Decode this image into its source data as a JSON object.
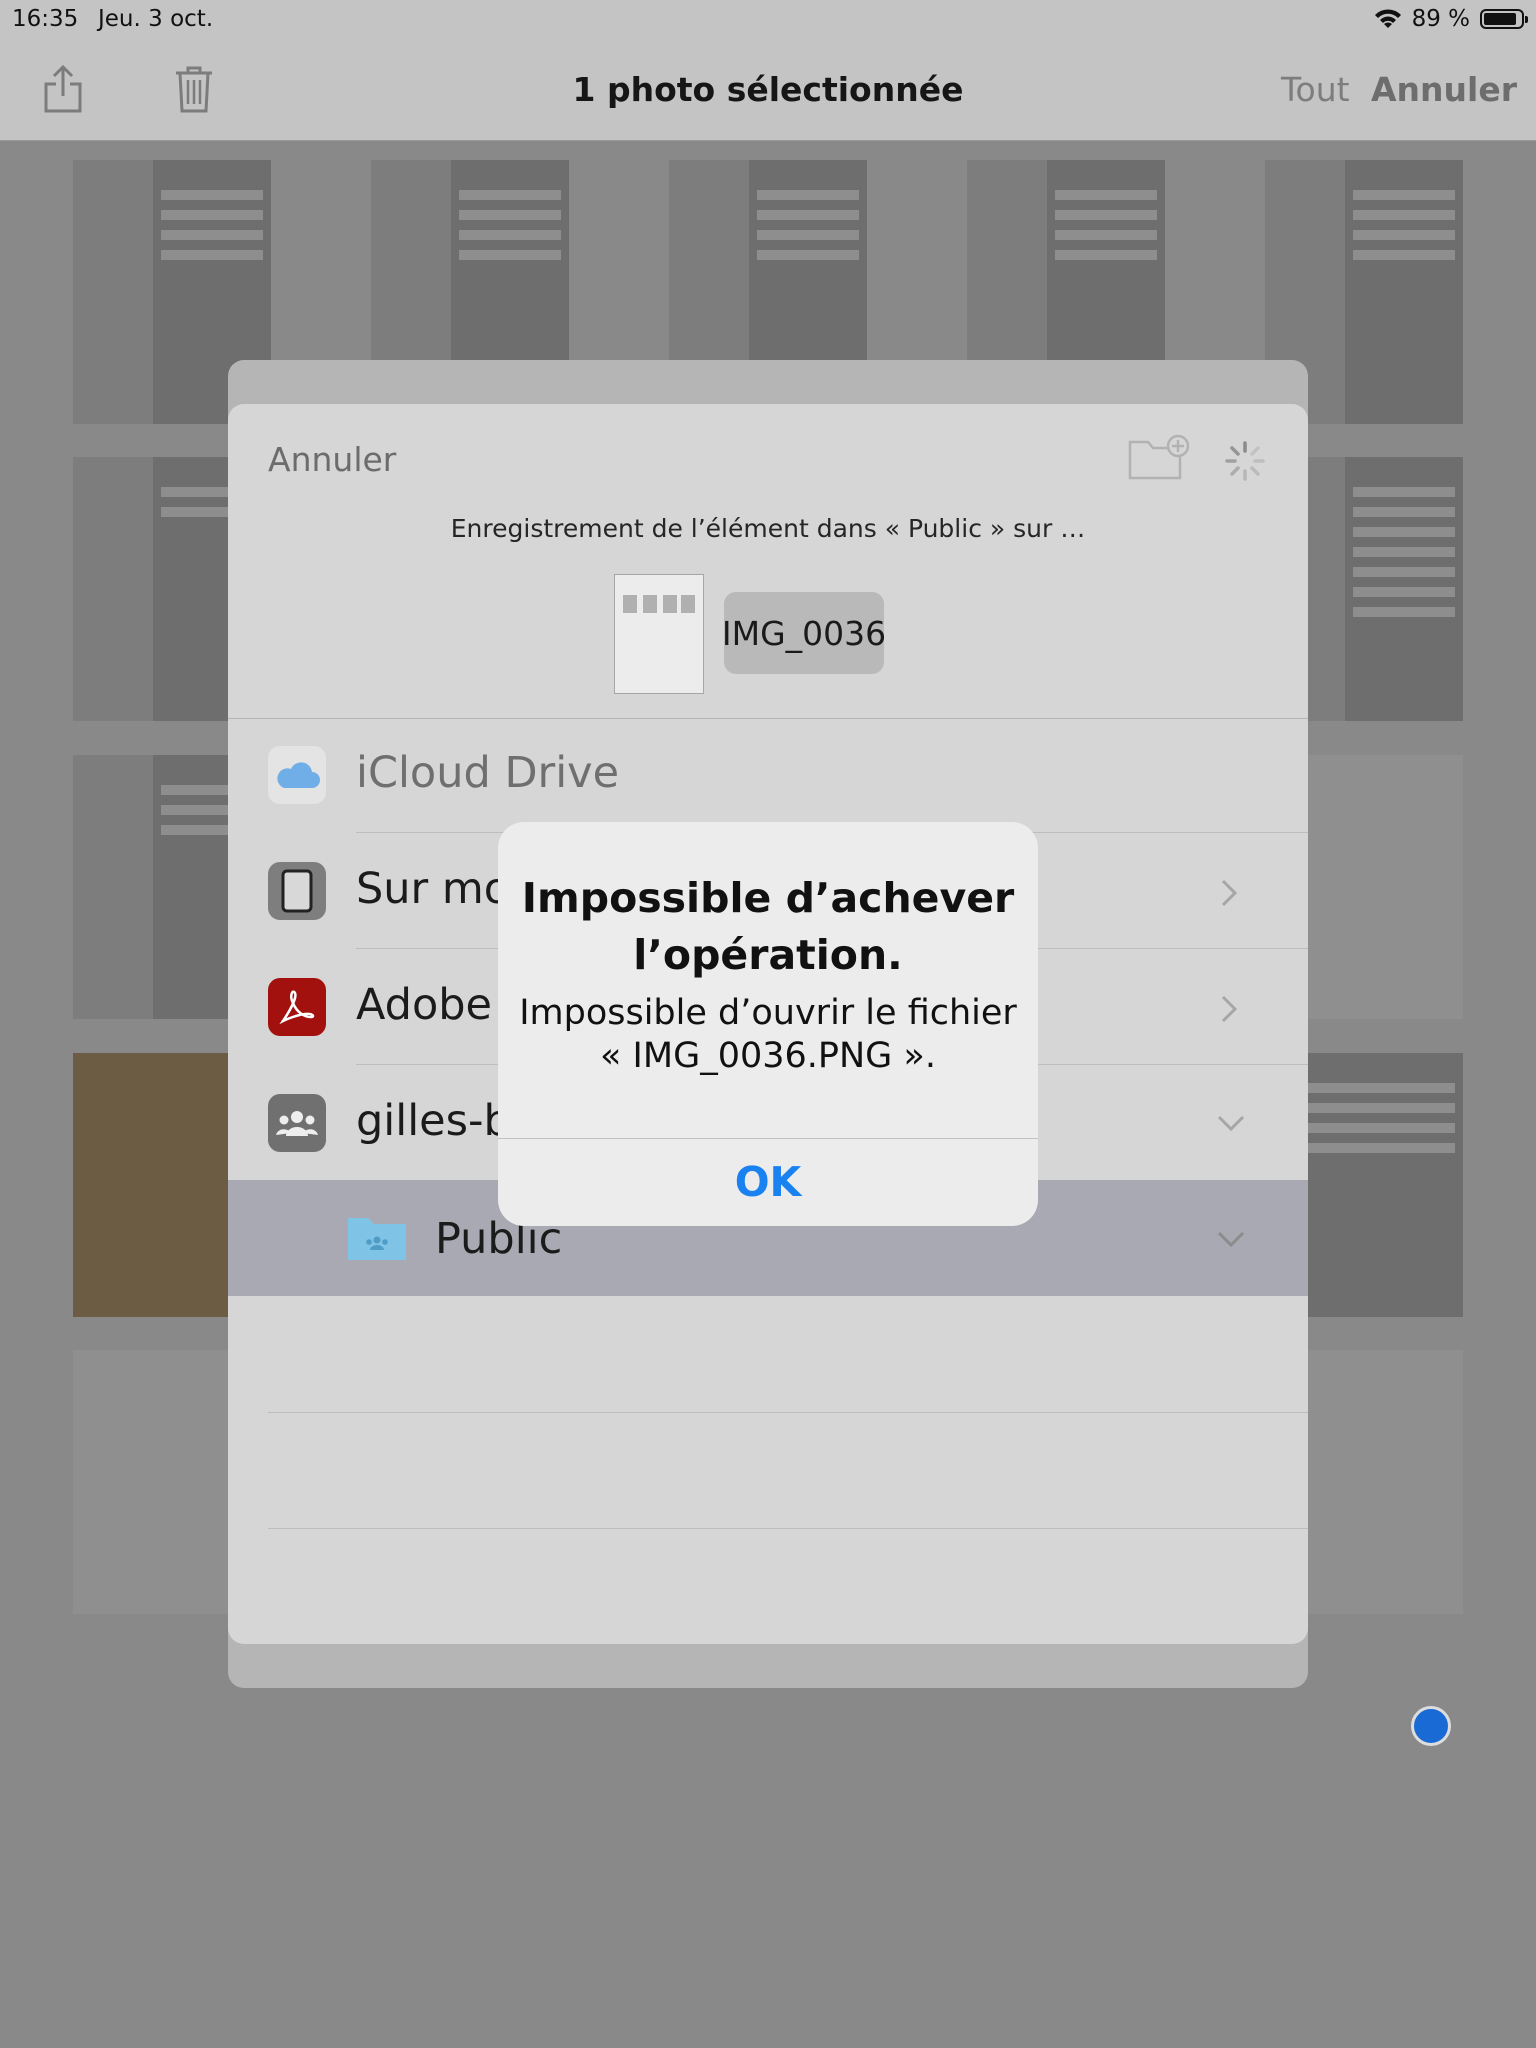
{
  "status_bar": {
    "time": "16:35",
    "date": "Jeu. 3 oct.",
    "battery": "89 %",
    "battery_level": 0.89
  },
  "toolbar": {
    "title": "1 photo sélectionnée",
    "select_all": "Tout",
    "cancel": "Annuler",
    "share_icon": "share-icon",
    "trash_icon": "trash-icon"
  },
  "share_sheet": {
    "cancel": "Annuler",
    "saving_text": "Enregistrement de l’élément dans « Public » sur …",
    "file_name": "IMG_0036",
    "new_folder_icon": "new-folder-icon",
    "locations": [
      {
        "label": "iCloud Drive",
        "icon": "icloud-icon"
      },
      {
        "label": "Sur mo",
        "icon": "ipad-icon"
      },
      {
        "label": "Adobe",
        "icon": "adobe-icon"
      },
      {
        "label": "gilles-b",
        "icon": "shared-users-icon"
      },
      {
        "label": "Public",
        "icon": "shared-folder-icon"
      }
    ]
  },
  "alert": {
    "title": "Impossible d’achever l’opération.",
    "message": "Impossible d’ouvrir le fichier « IMG_0036.PNG ».",
    "ok": "OK"
  },
  "colors": {
    "accent": "#1a82f0",
    "sheet": "#d6d6d6",
    "selected_row": "#a9a9b3"
  }
}
